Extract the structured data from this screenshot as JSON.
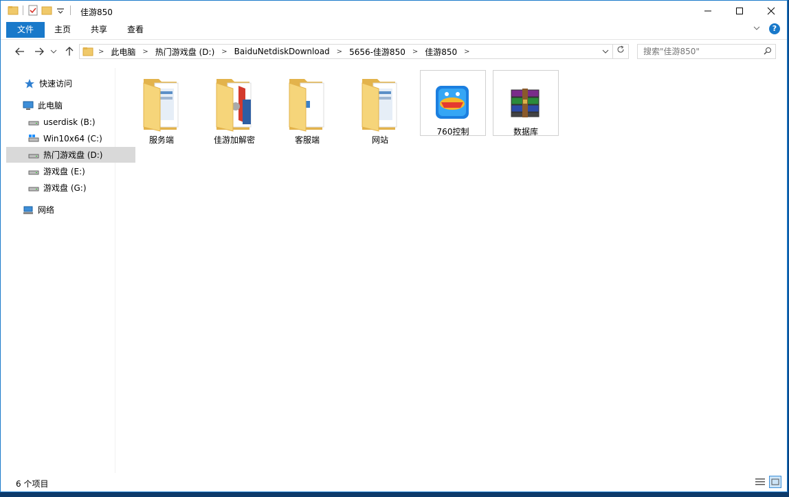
{
  "window": {
    "title": "佳游850"
  },
  "ribbon": {
    "tabs": [
      "文件",
      "主页",
      "共享",
      "查看"
    ]
  },
  "address": {
    "crumbs": [
      "此电脑",
      "热门游戏盘 (D:)",
      "BaiduNetdiskDownload",
      "5656-佳游850",
      "佳游850"
    ],
    "search_placeholder": "搜索\"佳游850\""
  },
  "sidebar": {
    "items": [
      {
        "label": "快速访问",
        "icon": "star-icon"
      },
      {
        "label": "此电脑",
        "icon": "computer-icon"
      },
      {
        "label": "userdisk (B:)",
        "icon": "drive-icon"
      },
      {
        "label": "Win10x64 (C:)",
        "icon": "windows-drive-icon"
      },
      {
        "label": "热门游戏盘 (D:)",
        "icon": "drive-icon",
        "selected": true
      },
      {
        "label": "游戏盘 (E:)",
        "icon": "drive-icon"
      },
      {
        "label": "游戏盘 (G:)",
        "icon": "drive-icon"
      },
      {
        "label": "网络",
        "icon": "network-icon"
      }
    ]
  },
  "files": [
    {
      "name": "服务端",
      "type": "folder"
    },
    {
      "name": "佳游加解密",
      "type": "folder"
    },
    {
      "name": "客服端",
      "type": "folder"
    },
    {
      "name": "网站",
      "type": "folder"
    },
    {
      "name": "760控制",
      "type": "app"
    },
    {
      "name": "数据库",
      "type": "archive"
    }
  ],
  "status": {
    "count": "6 个项目"
  },
  "colors": {
    "accent": "#1979ca",
    "folder": "#f0c96a",
    "selected_nav": "#d9d9d9"
  }
}
